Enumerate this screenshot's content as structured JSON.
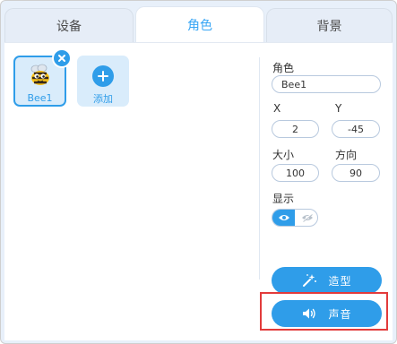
{
  "tabs": [
    {
      "label": "设备",
      "active": false
    },
    {
      "label": "角色",
      "active": true
    },
    {
      "label": "背景",
      "active": false
    }
  ],
  "sprites": [
    {
      "name": "Bee1",
      "selected": true,
      "icon": "bee-icon"
    }
  ],
  "add_sprite": {
    "label": "添加",
    "icon": "plus-icon"
  },
  "properties": {
    "name_label": "角色",
    "name_value": "Bee1",
    "x_label": "X",
    "x_value": "2",
    "y_label": "Y",
    "y_value": "-45",
    "size_label": "大小",
    "size_value": "100",
    "direction_label": "方向",
    "direction_value": "90",
    "show_label": "显示",
    "show_state": "visible"
  },
  "actions": {
    "costumes_label": "造型",
    "costumes_icon": "magic-wand-icon",
    "sounds_label": "声音",
    "sounds_icon": "speaker-icon"
  },
  "colors": {
    "accent": "#2f9de9",
    "highlight": "#e23b3b"
  }
}
